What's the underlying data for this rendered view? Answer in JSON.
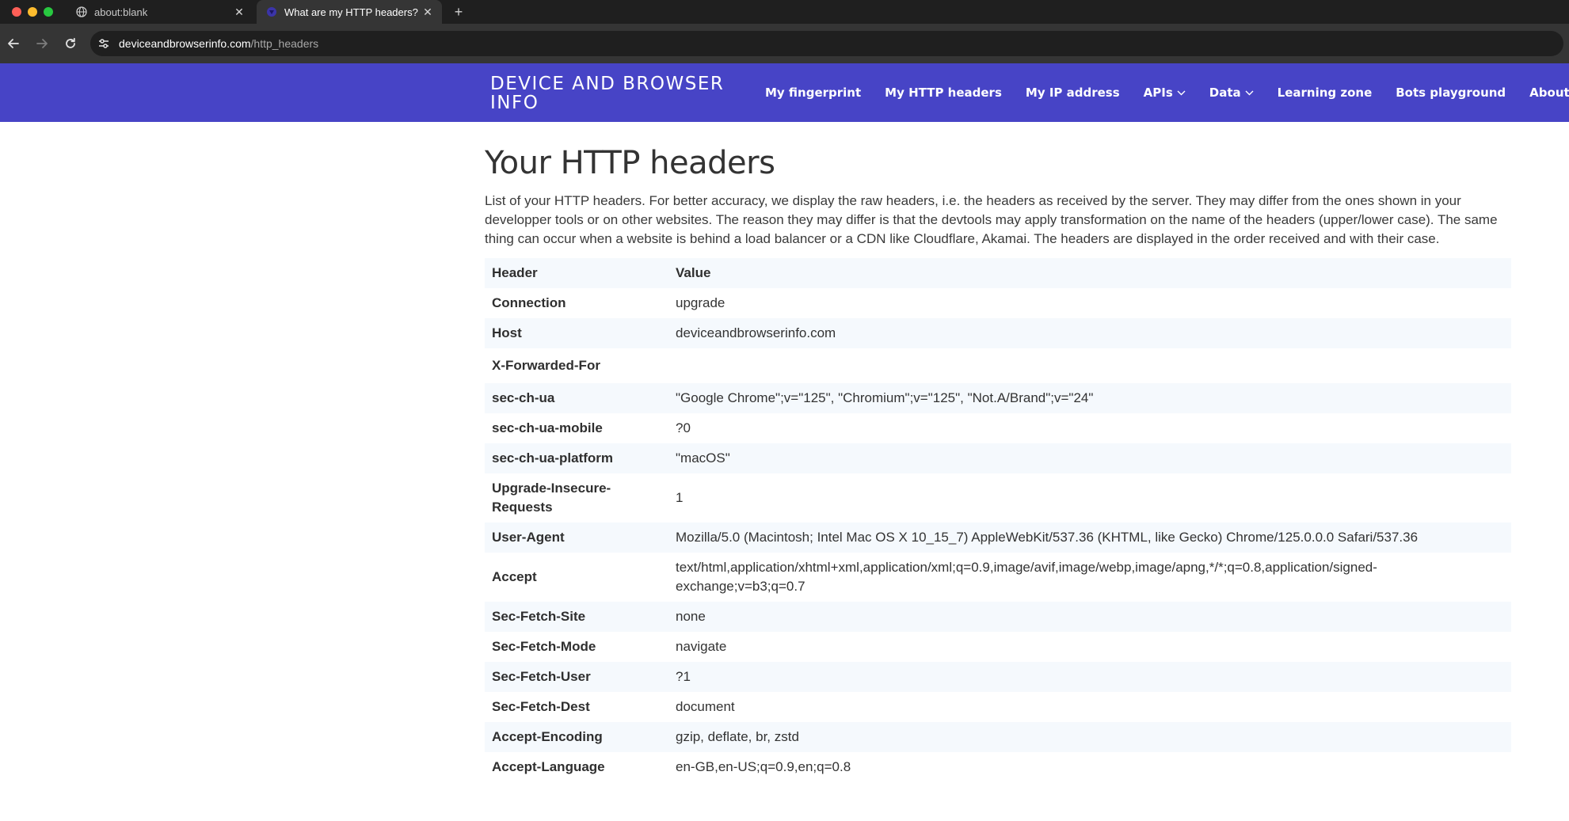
{
  "browser": {
    "tabs": [
      {
        "title": "about:blank",
        "icon": "globe-icon",
        "active": false
      },
      {
        "title": "What are my HTTP headers?",
        "icon": "site-favicon",
        "active": true
      }
    ],
    "url_host": "deviceandbrowserinfo.com",
    "url_path": "/http_headers"
  },
  "site": {
    "logo": "DEVICE AND BROWSER INFO",
    "nav": [
      {
        "label": "My fingerprint",
        "dropdown": false
      },
      {
        "label": "My HTTP headers",
        "dropdown": false
      },
      {
        "label": "My IP address",
        "dropdown": false
      },
      {
        "label": "APIs",
        "dropdown": true
      },
      {
        "label": "Data",
        "dropdown": true
      },
      {
        "label": "Learning zone",
        "dropdown": false
      },
      {
        "label": "Bots playground",
        "dropdown": false
      },
      {
        "label": "About",
        "dropdown": false
      }
    ],
    "colors": {
      "header_bg": "#4744c6",
      "row_alt": "#f5f9fd"
    }
  },
  "page": {
    "title": "Your HTTP headers",
    "intro": "List of your HTTP headers. For better accuracy, we display the raw headers, i.e. the headers as received by the server. They may differ from the ones shown in your developper tools or on other websites. The reason they may differ is that the devtools may apply transformation on the name of the headers (upper/lower case). The same thing can occur when a website is behind a load balancer or a CDN like Cloudflare, Akamai. The headers are displayed in the order received and with their case.",
    "table": {
      "col_header": "Header",
      "col_value": "Value",
      "rows": [
        {
          "header": "Connection",
          "value": "upgrade"
        },
        {
          "header": "Host",
          "value": "deviceandbrowserinfo.com"
        },
        {
          "header": "X-Forwarded-For",
          "value": ""
        },
        {
          "header": "sec-ch-ua",
          "value": "\"Google Chrome\";v=\"125\", \"Chromium\";v=\"125\", \"Not.A/Brand\";v=\"24\""
        },
        {
          "header": "sec-ch-ua-mobile",
          "value": "?0"
        },
        {
          "header": "sec-ch-ua-platform",
          "value": "\"macOS\""
        },
        {
          "header": "Upgrade-Insecure-Requests",
          "value": "1"
        },
        {
          "header": "User-Agent",
          "value": "Mozilla/5.0 (Macintosh; Intel Mac OS X 10_15_7) AppleWebKit/537.36 (KHTML, like Gecko) Chrome/125.0.0.0 Safari/537.36"
        },
        {
          "header": "Accept",
          "value": "text/html,application/xhtml+xml,application/xml;q=0.9,image/avif,image/webp,image/apng,*/*;q=0.8,application/signed-exchange;v=b3;q=0.7"
        },
        {
          "header": "Sec-Fetch-Site",
          "value": "none"
        },
        {
          "header": "Sec-Fetch-Mode",
          "value": "navigate"
        },
        {
          "header": "Sec-Fetch-User",
          "value": "?1"
        },
        {
          "header": "Sec-Fetch-Dest",
          "value": "document"
        },
        {
          "header": "Accept-Encoding",
          "value": "gzip, deflate, br, zstd"
        },
        {
          "header": "Accept-Language",
          "value": "en-GB,en-US;q=0.9,en;q=0.8"
        }
      ]
    }
  }
}
